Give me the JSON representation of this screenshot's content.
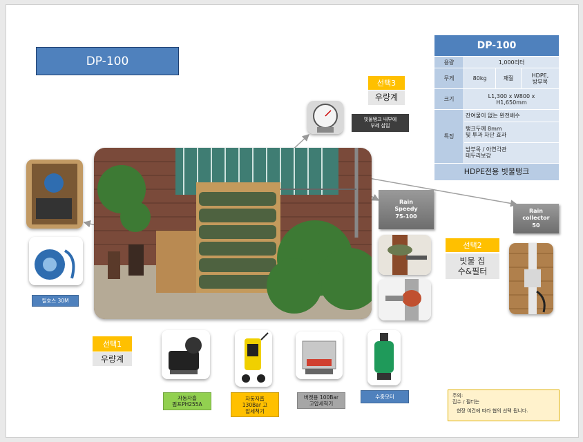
{
  "title": "DP-100",
  "spec": {
    "header": "DP-100",
    "capacity_label": "용량",
    "capacity_value": "1,000리터",
    "weight_label": "무게",
    "weight_value": "80kg",
    "material_label": "재질",
    "material_value": "HDPE,\n방부목",
    "size_label": "크기",
    "size_value": "L1,300  x  W800  x\nH1,650mm",
    "feature_label": "특징",
    "features": [
      "잔여물이 없는 완전배수",
      "탱크두께 8mm\n빛 투과 차단 효과",
      "방부목 / 아연각관\n테두리보강"
    ],
    "footer": "HDPE전용 빗물탱크"
  },
  "options": {
    "opt3_tag": "선택3",
    "opt3_label": "우량계",
    "opt2_tag": "선택2",
    "opt2_label": "빗물 집\n수&필터",
    "opt1_tag": "선택1",
    "opt1_label": "우량계"
  },
  "callouts": {
    "inside_note": "빗물탱크 내부에\n부레 삽입",
    "rain_speedy": "Rain\nSpeedy\n75-100",
    "rain_collector": "Rain\ncollector\n50"
  },
  "captions": {
    "hose": "릴호스 30M",
    "pump": "자동자흡\n펌프PH255A",
    "washer": "자동자흡\n130Bar 고\n압세척기",
    "bucket": "버켓용 100Bar\n고압세척기",
    "submersible": "수중모터"
  },
  "note": {
    "title": "주의:",
    "line1": "집수 / 필터는",
    "line2": "현장 여건에 따라 협의 선택 됩니다."
  },
  "colors": {
    "title_blue": "#4f81bd",
    "option_gold": "#ffc000",
    "caption_green": "#92d050",
    "caption_gray": "#a6a6a6",
    "caption_blue": "#4f81bd"
  }
}
